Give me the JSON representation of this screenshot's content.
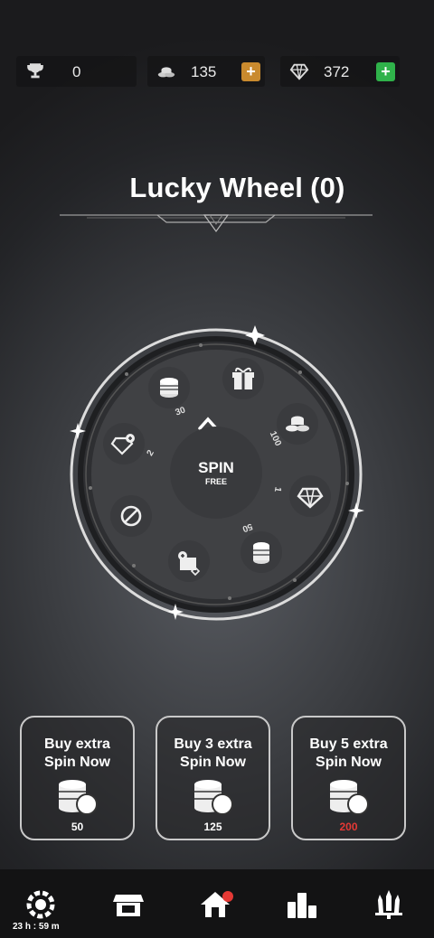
{
  "stats": {
    "trophies": "0",
    "coins": "135",
    "gems": "372",
    "plus_label": "+"
  },
  "title": {
    "text": "Lucky Wheel",
    "count": "(0)"
  },
  "wheel": {
    "spin_label": "SPIN",
    "spin_sub": "FREE",
    "segments": [
      {
        "icon": "gift-icon",
        "amount": ""
      },
      {
        "icon": "coin-stack-icon",
        "amount": "100"
      },
      {
        "icon": "gem-icon",
        "amount": "1"
      },
      {
        "icon": "coin-stack-icon",
        "amount": "50"
      },
      {
        "icon": "gem-plus-icon",
        "amount": ""
      },
      {
        "icon": "no-entry-icon",
        "amount": ""
      },
      {
        "icon": "gem-plus-icon",
        "amount": "2"
      },
      {
        "icon": "coin-stack-icon",
        "amount": "30"
      }
    ]
  },
  "offers": [
    {
      "label_line1": "Buy extra",
      "label_line2": "Spin Now",
      "price": "50",
      "price_color": "#ffffff"
    },
    {
      "label_line1": "Buy 3 extra",
      "label_line2": "Spin Now",
      "price": "125",
      "price_color": "#ffffff"
    },
    {
      "label_line1": "Buy 5 extra",
      "label_line2": "Spin Now",
      "price": "200",
      "price_color": "#e53935"
    }
  ],
  "nav": {
    "timer": "23 h : 59 m",
    "items": [
      "wheel-icon",
      "shop-icon",
      "home-icon",
      "leaderboard-icon",
      "swords-icon"
    ]
  },
  "colors": {
    "coin_plus": "#c98a2e",
    "gem_plus": "#2fb24a",
    "notification": "#e53935"
  }
}
